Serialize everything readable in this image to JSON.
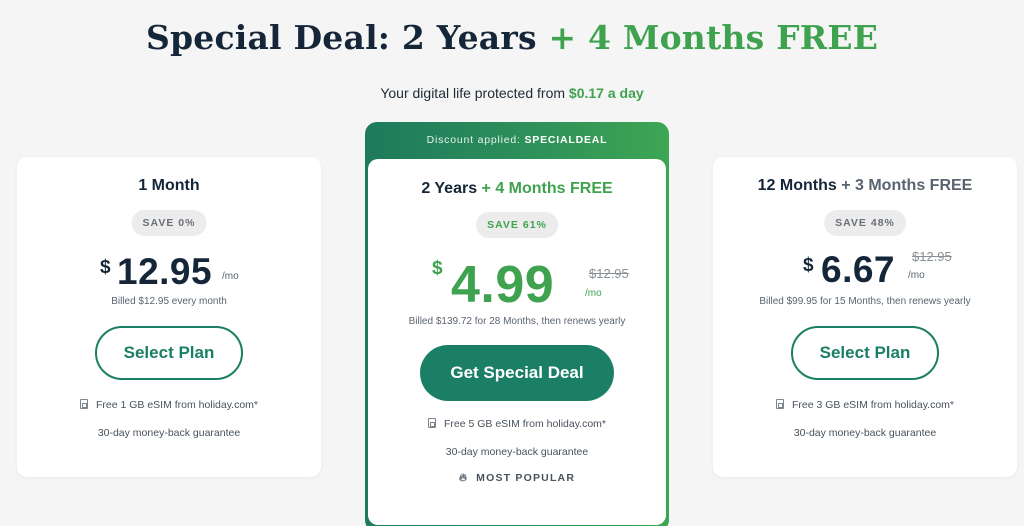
{
  "header": {
    "headline_main": "Special Deal: 2 Years",
    "headline_accent": "+ 4 Months FREE",
    "subline_text": "Your digital life protected from",
    "subline_price": "$0.17 a day"
  },
  "plans": [
    {
      "title": "1 Month",
      "title_accent": "",
      "save_badge": "SAVE 0%",
      "currency": "$",
      "price": "12.95",
      "per": "/mo",
      "old_price": "",
      "billed": "Billed $12.95 every month",
      "button_label": "Select Plan",
      "feature_esim": "Free 1 GB eSIM from holiday.com*",
      "feature_guarantee": "30-day money-back guarantee"
    },
    {
      "banner_label": "Discount applied:",
      "banner_code": "SPECIALDEAL",
      "title": "2 Years",
      "title_accent": "+ 4 Months FREE",
      "save_badge": "SAVE 61%",
      "currency": "$",
      "price": "4.99",
      "per": "/mo",
      "old_price": "$12.95",
      "billed": "Billed $139.72 for 28 Months, then renews yearly",
      "button_label": "Get Special Deal",
      "feature_esim": "Free 5 GB eSIM from holiday.com*",
      "feature_guarantee": "30-day money-back guarantee",
      "popular_label": "MOST POPULAR",
      "popular_icon": "flame-icon"
    },
    {
      "title": "12 Months",
      "title_accent": "+ 3 Months FREE",
      "save_badge": "SAVE 48%",
      "currency": "$",
      "price": "6.67",
      "per": "/mo",
      "old_price": "$12.95",
      "billed": "Billed $99.95 for 15 Months, then renews yearly",
      "button_label": "Select Plan",
      "feature_esim": "Free 3 GB eSIM from holiday.com*",
      "feature_guarantee": "30-day money-back guarantee"
    }
  ],
  "colors": {
    "brand_green": "#1a7f64",
    "accent_green": "#3fa24f",
    "navy_text": "#142638",
    "background": "#f5f5f5"
  },
  "icons": {
    "esim": "sim-card-icon",
    "popular": "flame-icon"
  }
}
